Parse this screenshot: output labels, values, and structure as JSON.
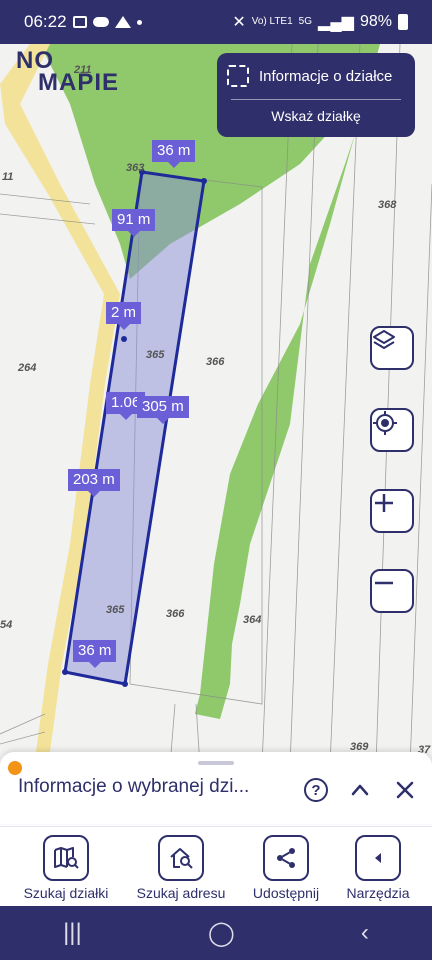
{
  "status_bar": {
    "time": "06:22",
    "net_label": "Vo) LTE1",
    "net_type": "5G",
    "battery": "98%"
  },
  "map": {
    "logo_line1": "NO",
    "logo_line2": "MAPIE",
    "info_panel": {
      "title": "Informacje o działce",
      "button_label": "Wskaż działkę"
    },
    "measurements": [
      "36 m",
      "91 m",
      "2 m",
      "1.06",
      "305 m",
      "203 m",
      "36 m"
    ],
    "parcels": [
      "363",
      "368",
      "211",
      "11",
      "264",
      "365",
      "366",
      "365",
      "366",
      "364",
      "369",
      "54",
      "37"
    ],
    "controls": {
      "layers_icon": "layers-icon",
      "locate_icon": "locate-icon",
      "zoom_in_icon": "plus-icon",
      "zoom_out_icon": "minus-icon"
    }
  },
  "sheet": {
    "title": "Informacje o wybranej dzi...",
    "help_icon": "help-icon",
    "collapse_icon": "chevron-up-icon",
    "close_icon": "close-icon"
  },
  "toolbar": {
    "items": [
      {
        "label": "Szukaj działki",
        "icon": "map-search-icon"
      },
      {
        "label": "Szukaj adresu",
        "icon": "home-search-icon"
      },
      {
        "label": "Udostępnij",
        "icon": "share-icon"
      },
      {
        "label": "Narzędzia",
        "icon": "chevron-left-icon"
      }
    ]
  },
  "colors": {
    "primary": "#2e2f6b",
    "measure": "#6a5fd6",
    "forest": "#8fc96b",
    "road": "#f3e39a",
    "accent": "#f29417"
  }
}
